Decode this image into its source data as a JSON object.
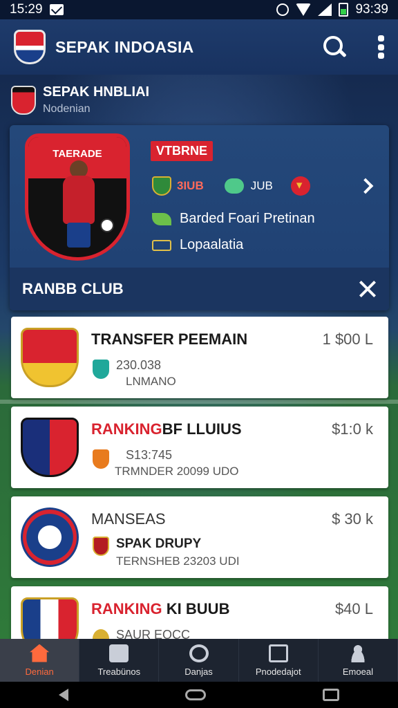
{
  "status_bar": {
    "time": "15:29",
    "battery_time": "93:39"
  },
  "app_bar": {
    "title": "SEPAK INDOASIA"
  },
  "sub_header": {
    "title": "SEPAK HNBLIAI",
    "caption": "Nodenian"
  },
  "featured": {
    "crest_text": "TAERADE",
    "tag": "VTBRNE",
    "stat1": "3IUB",
    "stat2": "JUB",
    "line1": "Barded Foari Pretinan",
    "line2": "Lopaalatia",
    "footer_title": "RANBB CLUB"
  },
  "list": {
    "items": [
      {
        "title": "TRANSFER PEEMAIN",
        "title_accent": "",
        "price": "1 $00 L",
        "line1": "230.038",
        "line2": "LNMANO"
      },
      {
        "title": "BF LLUIUS",
        "title_accent": "RANKING",
        "price": "$1:0 k",
        "line1": "S13:745",
        "line2": "TRMNDER 20099 UDO"
      },
      {
        "title": "MANSEAS",
        "title_accent": "",
        "price": "$ 30 k",
        "line1": "SPAK DRUPY",
        "line2": "TERNSHEB 23203 UDI"
      },
      {
        "title": "KI BUUB",
        "title_accent": "RANKING",
        "price": "$40 L",
        "line1": "SAUR EOCC",
        "line2": ""
      }
    ]
  },
  "bottom_nav": {
    "items": [
      {
        "label": "Denian"
      },
      {
        "label": "Treabünos"
      },
      {
        "label": "Danjas"
      },
      {
        "label": "Pnodedajot"
      },
      {
        "label": "Emoeal"
      }
    ]
  },
  "colors": {
    "accent": "#d9232f",
    "appbar": "#1e3b6b",
    "nav_active": "#ff6a3d"
  }
}
